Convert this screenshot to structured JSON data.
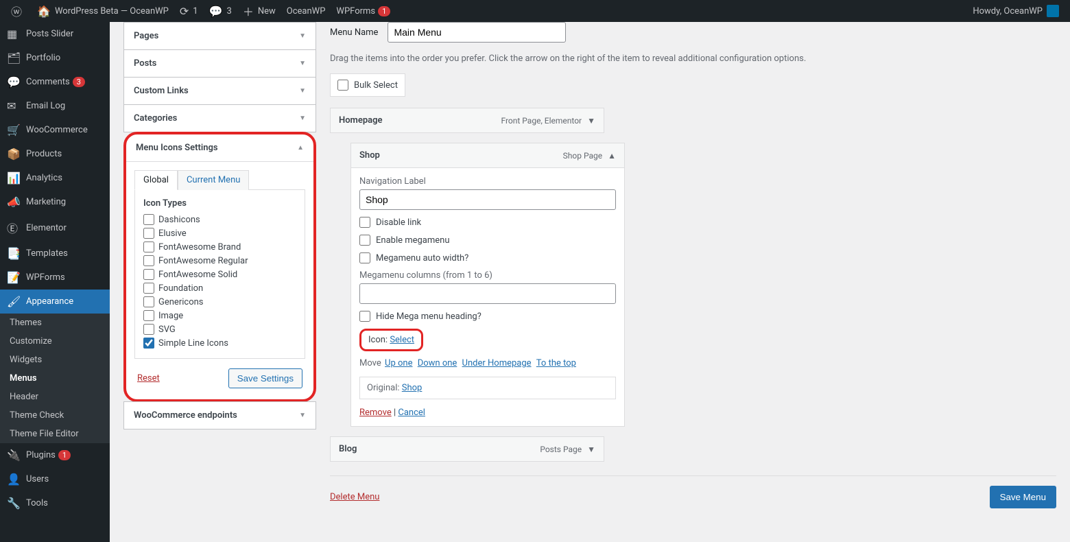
{
  "adminbar": {
    "site_title": "WordPress Beta — OceanWP",
    "refresh_count": "1",
    "comments_count": "3",
    "new_label": "New",
    "links": [
      "OceanWP",
      "WPForms"
    ],
    "wpforms_badge": "1",
    "howdy": "Howdy, OceanWP"
  },
  "sidebar": {
    "items": [
      {
        "icon": "▦",
        "label": "Posts Slider"
      },
      {
        "icon": "🗂",
        "label": "Portfolio"
      },
      {
        "icon": "💬",
        "label": "Comments",
        "badge": "3"
      },
      {
        "icon": "✉",
        "label": "Email Log"
      },
      {
        "icon": "🛒",
        "label": "WooCommerce"
      },
      {
        "icon": "📦",
        "label": "Products"
      },
      {
        "icon": "📊",
        "label": "Analytics"
      },
      {
        "icon": "📣",
        "label": "Marketing"
      },
      {
        "icon": "Ⓔ",
        "label": "Elementor"
      },
      {
        "icon": "📑",
        "label": "Templates"
      },
      {
        "icon": "📝",
        "label": "WPForms"
      },
      {
        "icon": "🖌",
        "label": "Appearance",
        "current": true
      },
      {
        "icon": "🔌",
        "label": "Plugins",
        "badge": "1"
      },
      {
        "icon": "👤",
        "label": "Users"
      },
      {
        "icon": "🔧",
        "label": "Tools"
      }
    ],
    "submenu": [
      "Themes",
      "Customize",
      "Widgets",
      "Menus",
      "Header",
      "Theme Check",
      "Theme File Editor"
    ],
    "submenu_current": "Menus"
  },
  "left_panels": [
    "Pages",
    "Posts",
    "Custom Links",
    "Categories"
  ],
  "icons_panel": {
    "title": "Menu Icons Settings",
    "tabs": [
      "Global",
      "Current Menu"
    ],
    "section_title": "Icon Types",
    "types": [
      {
        "label": "Dashicons",
        "checked": false
      },
      {
        "label": "Elusive",
        "checked": false
      },
      {
        "label": "FontAwesome Brand",
        "checked": false
      },
      {
        "label": "FontAwesome Regular",
        "checked": false
      },
      {
        "label": "FontAwesome Solid",
        "checked": false
      },
      {
        "label": "Foundation",
        "checked": false
      },
      {
        "label": "Genericons",
        "checked": false
      },
      {
        "label": "Image",
        "checked": false
      },
      {
        "label": "SVG",
        "checked": false
      },
      {
        "label": "Simple Line Icons",
        "checked": true
      }
    ],
    "reset": "Reset",
    "save": "Save Settings"
  },
  "woo_panel": "WooCommerce endpoints",
  "menu_editor": {
    "name_label": "Menu Name",
    "name_value": "Main Menu",
    "help": "Drag the items into the order you prefer. Click the arrow on the right of the item to reveal additional configuration options.",
    "bulk": "Bulk Select",
    "items": {
      "homepage": {
        "title": "Homepage",
        "meta": "Front Page, Elementor"
      },
      "shop": {
        "title": "Shop",
        "meta": "Shop Page",
        "nav_label_title": "Navigation Label",
        "nav_label_value": "Shop",
        "opts": [
          "Disable link",
          "Enable megamenu",
          "Megamenu auto width?"
        ],
        "mega_cols": "Megamenu columns (from 1 to 6)",
        "hide_heading": "Hide Mega menu heading?",
        "icon_label": "Icon: ",
        "icon_select": "Select",
        "move_label": "Move",
        "move_links": [
          "Up one",
          "Down one",
          "Under Homepage",
          "To the top"
        ],
        "original_label": "Original:",
        "original_link": "Shop",
        "remove": "Remove",
        "cancel": "Cancel"
      },
      "blog": {
        "title": "Blog",
        "meta": "Posts Page"
      }
    },
    "delete": "Delete Menu",
    "save": "Save Menu"
  }
}
